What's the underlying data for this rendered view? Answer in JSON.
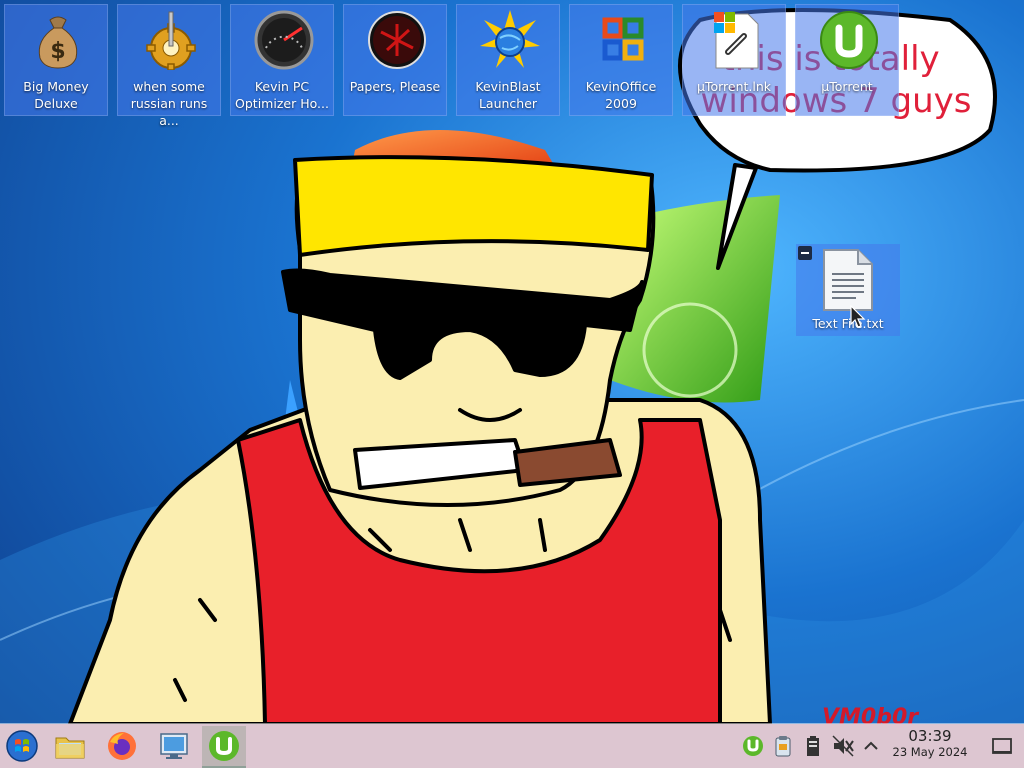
{
  "desktop_icons": [
    {
      "label": "Big Money Deluxe",
      "icon": "money-bag-icon"
    },
    {
      "label": "when some russian runs a...",
      "icon": "gear-icon"
    },
    {
      "label": "Kevin PC Optimizer Ho...",
      "icon": "speedometer-icon"
    },
    {
      "label": "Papers, Please",
      "icon": "papers-please-icon"
    },
    {
      "label": "KevinBlast Launcher",
      "icon": "globe-burst-icon"
    },
    {
      "label": "KevinOffice 2009",
      "icon": "office-logo-icon"
    },
    {
      "label": "µTorrent.lnk",
      "icon": "link-file-icon"
    },
    {
      "label": "µTorrent",
      "icon": "utorrent-icon"
    }
  ],
  "text_file": {
    "label": "Text File.txt",
    "icon": "text-document-icon"
  },
  "wallpaper": {
    "speech_bubble_text": "this is totally windows 7 guys",
    "signature": "VM0b0r"
  },
  "taskbar": {
    "buttons": [
      {
        "name": "start",
        "icon": "windows-start-icon"
      },
      {
        "name": "file-manager",
        "icon": "folder-icon"
      },
      {
        "name": "firefox",
        "icon": "firefox-icon"
      },
      {
        "name": "control-panel",
        "icon": "system-settings-icon"
      },
      {
        "name": "utorrent",
        "icon": "utorrent-icon",
        "active": true
      }
    ],
    "tray_icons": [
      "utorrent-tray-icon",
      "clipboard-icon",
      "storage-icon",
      "volume-muted-icon",
      "chevron-up-icon"
    ],
    "clock": {
      "time": "03:39",
      "date": "23 May 2024"
    }
  },
  "colors": {
    "desktop_blue": "#1a73d0",
    "taskbar_bg": "#ddc6d1",
    "selection": "#4678eb",
    "bubble_red": "#e0203a",
    "tank_top_red": "#e8202a",
    "headband_yellow": "#ffe600",
    "skin": "#fbeeb0"
  }
}
